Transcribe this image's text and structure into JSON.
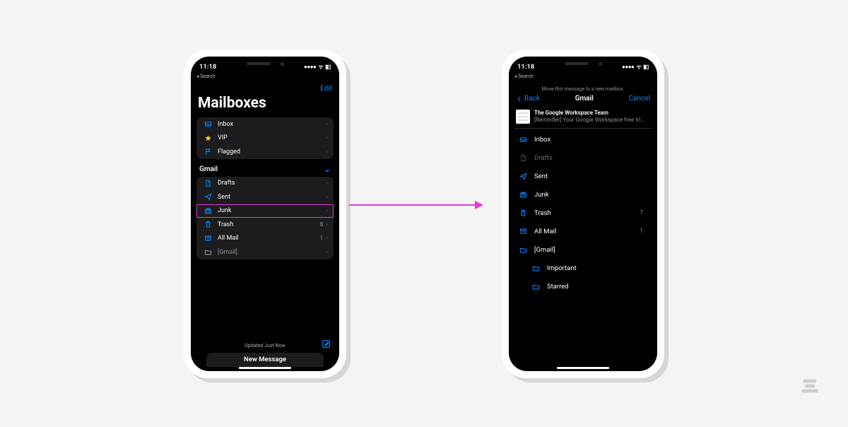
{
  "status": {
    "time": "11:18",
    "signal": "▮▮▮▮",
    "wifi": "📶",
    "battery": "▮▯",
    "back_search": "◂ Search"
  },
  "left": {
    "edit": "Edit",
    "title": "Mailboxes",
    "primary": [
      {
        "icon": "inbox",
        "label": "Inbox"
      },
      {
        "icon": "star",
        "label": "VIP"
      },
      {
        "icon": "flag",
        "label": "Flagged"
      }
    ],
    "account_header": "Gmail",
    "account_items": [
      {
        "icon": "doc",
        "label": "Drafts"
      },
      {
        "icon": "send",
        "label": "Sent"
      },
      {
        "icon": "junk",
        "label": "Junk",
        "highlight": true
      },
      {
        "icon": "trash",
        "label": "Trash",
        "count": "8"
      },
      {
        "icon": "archive",
        "label": "All Mail",
        "count": "1"
      },
      {
        "icon": "folder",
        "label": "[Gmail]",
        "muted": true
      }
    ],
    "updated": "Updated Just Now",
    "new_message": "New Message"
  },
  "right": {
    "move_banner": "Move this message to a new mailbox.",
    "back": "Back",
    "title": "Gmail",
    "cancel": "Cancel",
    "message": {
      "sender": "The Google Workspace Team",
      "subject": "[Reminder] Your Google Workspace free trial i…"
    },
    "folders": [
      {
        "icon": "inbox",
        "label": "Inbox"
      },
      {
        "icon": "doc",
        "label": "Drafts",
        "muted": true
      },
      {
        "icon": "send",
        "label": "Sent"
      },
      {
        "icon": "junk",
        "label": "Junk"
      },
      {
        "icon": "trash",
        "label": "Trash",
        "count": "7"
      },
      {
        "icon": "archive",
        "label": "All Mail",
        "count": "1"
      },
      {
        "icon": "folder",
        "label": "[Gmail]"
      }
    ],
    "nested": [
      {
        "icon": "folder",
        "label": "Important"
      },
      {
        "icon": "folder",
        "label": "Starred"
      }
    ]
  }
}
